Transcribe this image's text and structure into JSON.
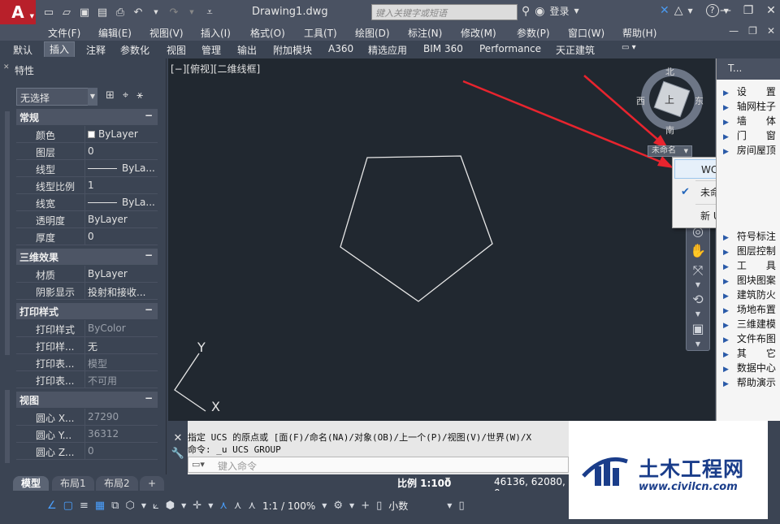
{
  "title_bar": {
    "app_logo": "A",
    "document_title": "Drawing1.dwg",
    "search_placeholder": "键入关键字或短语",
    "login_label": "登录",
    "help_label": "?"
  },
  "menu": [
    "文件(F)",
    "编辑(E)",
    "视图(V)",
    "插入(I)",
    "格式(O)",
    "工具(T)",
    "绘图(D)",
    "标注(N)",
    "修改(M)",
    "参数(P)",
    "窗口(W)",
    "帮助(H)"
  ],
  "ribbon_tabs": [
    "默认",
    "插入",
    "注释",
    "参数化",
    "视图",
    "管理",
    "输出",
    "附加模块",
    "A360",
    "精选应用",
    "BIM 360",
    "Performance",
    "天正建筑"
  ],
  "ribbon_active": "插入",
  "properties": {
    "title": "特性",
    "selection": "无选择",
    "sections": [
      {
        "name": "常规",
        "rows": [
          {
            "key": "颜色",
            "value": "ByLayer",
            "style": "color"
          },
          {
            "key": "图层",
            "value": "0",
            "style": ""
          },
          {
            "key": "线型",
            "value": "ByLa...",
            "style": "line"
          },
          {
            "key": "线型比例",
            "value": "1",
            "style": ""
          },
          {
            "key": "线宽",
            "value": "ByLa...",
            "style": "line"
          },
          {
            "key": "透明度",
            "value": "ByLayer",
            "style": ""
          },
          {
            "key": "厚度",
            "value": "0",
            "style": ""
          }
        ]
      },
      {
        "name": "三维效果",
        "rows": [
          {
            "key": "材质",
            "value": "ByLayer",
            "style": ""
          },
          {
            "key": "阴影显示",
            "value": "投射和接收...",
            "style": ""
          }
        ]
      },
      {
        "name": "打印样式",
        "rows": [
          {
            "key": "打印样式",
            "value": "ByColor",
            "style": "dim"
          },
          {
            "key": "打印样...",
            "value": "无",
            "style": ""
          },
          {
            "key": "打印表...",
            "value": "模型",
            "style": "dim"
          },
          {
            "key": "打印表...",
            "value": "不可用",
            "style": "dim"
          }
        ]
      },
      {
        "name": "视图",
        "rows": [
          {
            "key": "圆心 X...",
            "value": "27290",
            "style": "dim"
          },
          {
            "key": "圆心 Y...",
            "value": "36312",
            "style": "dim"
          },
          {
            "key": "圆心 Z...",
            "value": "0",
            "style": "dim"
          }
        ]
      }
    ]
  },
  "viewport": {
    "label": "[−][俯视][二维线框]",
    "ucs_x": "X",
    "ucs_y": "Y"
  },
  "viewcube": {
    "north": "北",
    "south": "南",
    "east": "东",
    "west": "西",
    "face": "上",
    "ucs_name": "未命名"
  },
  "ucs_menu": {
    "items": [
      {
        "label": "WCS",
        "checked": false,
        "hover": true
      },
      {
        "label": "未命名",
        "checked": true,
        "hover": false
      },
      {
        "label": "新 UCS",
        "checked": false,
        "hover": false
      }
    ]
  },
  "palette": {
    "title": "T...",
    "items_top": [
      "设　　置",
      "轴网柱子",
      "墙　　体",
      "门　　窗",
      "房间屋顶"
    ],
    "items_bottom": [
      "符号标注",
      "图层控制",
      "工　　具",
      "图块图案",
      "建筑防火",
      "场地布置",
      "三维建模",
      "文件布图",
      "其　　它",
      "数据中心",
      "帮助演示"
    ]
  },
  "command": {
    "history1": "指定 UCS 的原点或 [面(F)/命名(NA)/对象(OB)/上一个(P)/视图(V)/世界(W)/X",
    "history2": "命令: _u UCS GROUP",
    "input_placeholder": "键入命令"
  },
  "layout_tabs": [
    "模型",
    "布局1",
    "布局2"
  ],
  "status": {
    "scale": "比例 1:100",
    "coords": "46136, 62080, 0",
    "zoom": "1:1 / 100%",
    "units": "小数"
  },
  "watermark": {
    "title": "土木工程网",
    "url": "www.civilcn.com"
  },
  "colors": {
    "accent_red": "#b8202a",
    "drawing_bg": "#212830",
    "ui_dark": "#3b4453",
    "watermark_blue": "#1a3d8a"
  }
}
